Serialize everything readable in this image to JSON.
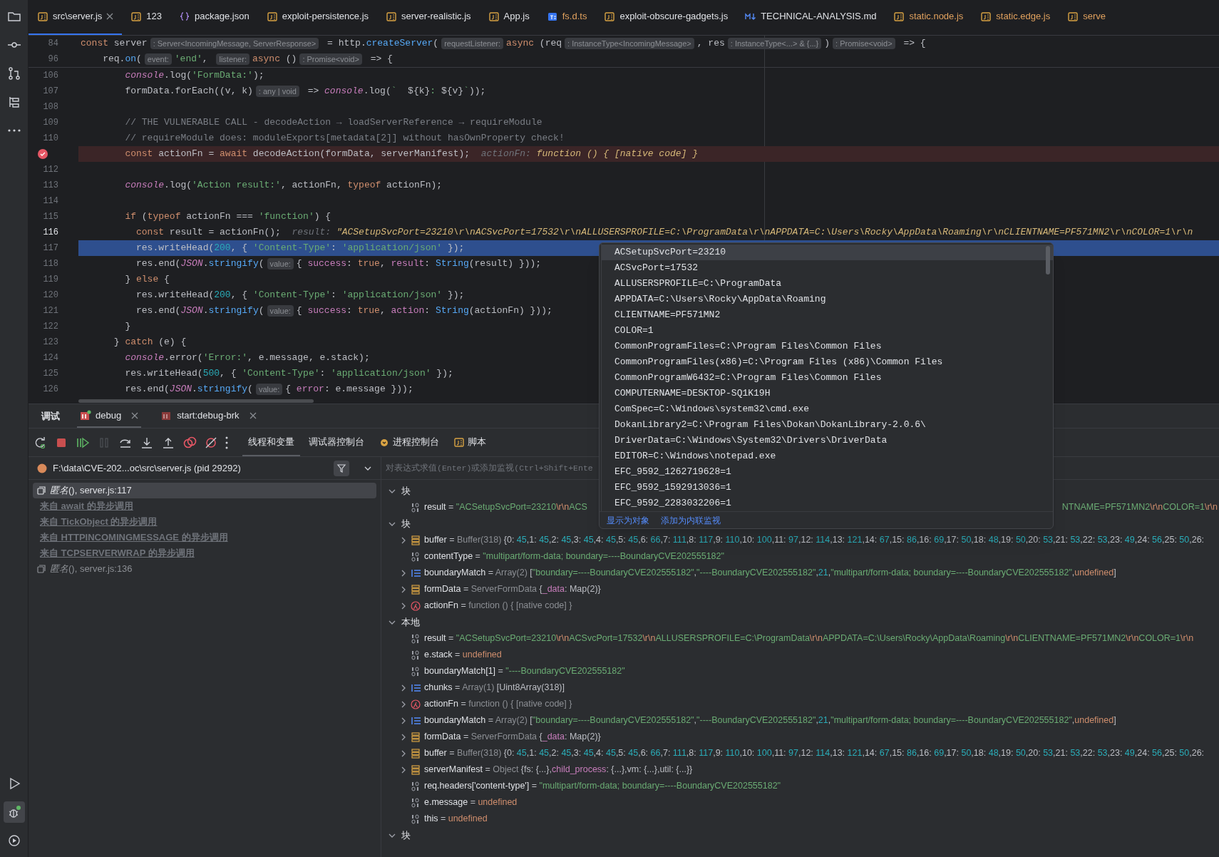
{
  "activity_bar": {
    "top": [
      {
        "kind": "folder",
        "selected": false
      },
      {
        "kind": "commit",
        "selected": false
      },
      {
        "kind": "pull-request",
        "selected": false
      },
      {
        "kind": "structure",
        "selected": false
      },
      {
        "kind": "more",
        "selected": false
      }
    ],
    "bottom": [
      {
        "kind": "run",
        "selected": false
      },
      {
        "kind": "debug",
        "selected": true
      },
      {
        "kind": "services",
        "selected": false
      }
    ]
  },
  "tabs": [
    {
      "label": "src\\server.js",
      "kind": "js",
      "selected": true,
      "color": "#dfe1e5"
    },
    {
      "label": "123",
      "kind": "js",
      "selected": false,
      "color": "#dfe1e5"
    },
    {
      "label": "package.json",
      "kind": "json",
      "selected": false,
      "color": "#dfe1e5"
    },
    {
      "label": "exploit-persistence.js",
      "kind": "js",
      "selected": false,
      "color": "#dfe1e5"
    },
    {
      "label": "server-realistic.js",
      "kind": "js",
      "selected": false,
      "color": "#dfe1e5"
    },
    {
      "label": "App.js",
      "kind": "js",
      "selected": false,
      "color": "#dfe1e5"
    },
    {
      "label": "fs.d.ts",
      "kind": "ts",
      "selected": false,
      "color": "#e0a15e"
    },
    {
      "label": "exploit-obscure-gadgets.js",
      "kind": "js",
      "selected": false,
      "color": "#dfe1e5"
    },
    {
      "label": "TECHNICAL-ANALYSIS.md",
      "kind": "md",
      "selected": false,
      "color": "#dfe1e5"
    },
    {
      "label": "static.node.js",
      "kind": "js",
      "selected": false,
      "color": "#e0a15e"
    },
    {
      "label": "static.edge.js",
      "kind": "js",
      "selected": false,
      "color": "#e0a15e"
    },
    {
      "label": "serve",
      "kind": "js",
      "selected": false,
      "color": "#e0a15e"
    }
  ],
  "sticky_lines": [
    {
      "n": "84",
      "tokens": [
        {
          "kind": "k",
          "text": "const "
        },
        {
          "kind": "p",
          "text": "server"
        },
        {
          "kind": "h",
          "text": ": Server<IncomingMessage, ServerResponse>"
        },
        {
          "kind": "p",
          "text": " = http."
        },
        {
          "kind": "f",
          "text": "createServer"
        },
        {
          "kind": "p",
          "text": "("
        },
        {
          "kind": "h",
          "text": "requestListener:"
        },
        {
          "kind": "k",
          "text": "async "
        },
        {
          "kind": "p",
          "text": "(req"
        },
        {
          "kind": "h",
          "text": ": InstanceType<IncomingMessage>"
        },
        {
          "kind": "p",
          "text": ", res"
        },
        {
          "kind": "h",
          "text": ": InstanceType<...> & {...}"
        },
        {
          "kind": "p",
          "text": ")"
        },
        {
          "kind": "h",
          "text": ": Promise<void>"
        },
        {
          "kind": "p",
          "text": " => {"
        }
      ]
    },
    {
      "n": "96",
      "tokens": [
        {
          "kind": "p",
          "text": "    req."
        },
        {
          "kind": "f",
          "text": "on"
        },
        {
          "kind": "p",
          "text": "("
        },
        {
          "kind": "h",
          "text": "event:"
        },
        {
          "kind": "s",
          "text": "'end'"
        },
        {
          "kind": "p",
          "text": ", "
        },
        {
          "kind": "h",
          "text": "listener:"
        },
        {
          "kind": "k",
          "text": "async "
        },
        {
          "kind": "p",
          "text": "()"
        },
        {
          "kind": "h",
          "text": ": Promise<void>"
        },
        {
          "kind": "p",
          "text": " => {"
        }
      ]
    }
  ],
  "code_lines": [
    {
      "n": "106",
      "breakpoint": false,
      "current_line": false,
      "caret": false,
      "tokens": [
        {
          "kind": "i",
          "text": "        console"
        },
        {
          "kind": "p",
          "text": ".log("
        },
        {
          "kind": "s",
          "text": "'FormData:'"
        },
        {
          "kind": "p",
          "text": ");"
        }
      ]
    },
    {
      "n": "107",
      "breakpoint": false,
      "current_line": false,
      "caret": false,
      "tokens": [
        {
          "kind": "p",
          "text": "        formData.forEach((v, k)"
        },
        {
          "kind": "h",
          "text": ": any | void"
        },
        {
          "kind": "p",
          "text": " => "
        },
        {
          "kind": "i",
          "text": "console"
        },
        {
          "kind": "p",
          "text": ".log("
        },
        {
          "kind": "s",
          "text": "`  "
        },
        {
          "kind": "p",
          "text": "${k}"
        },
        {
          "kind": "s",
          "text": ": "
        },
        {
          "kind": "p",
          "text": "${v}"
        },
        {
          "kind": "s",
          "text": "`"
        },
        {
          "kind": "p",
          "text": "));"
        }
      ]
    },
    {
      "n": "108",
      "breakpoint": false,
      "current_line": false,
      "caret": false
    },
    {
      "n": "109",
      "breakpoint": false,
      "current_line": false,
      "caret": false,
      "tokens": [
        {
          "kind": "c",
          "text": "        // THE VULNERABLE CALL - decodeAction → loadServerReference → requireModule"
        }
      ]
    },
    {
      "n": "110",
      "breakpoint": false,
      "current_line": false,
      "caret": false,
      "tokens": [
        {
          "kind": "c",
          "text": "        // requireModule does: moduleExports[metadata[2]] without hasOwnProperty check!"
        }
      ]
    },
    {
      "breakpoint": true,
      "current_line": false,
      "tokens": [
        {
          "kind": "k",
          "text": "        const "
        },
        {
          "kind": "p",
          "text": "actionFn = "
        },
        {
          "kind": "k",
          "text": "await "
        },
        {
          "kind": "p",
          "text": "decodeAction(formData, serverManifest);"
        },
        {
          "kind": "dl",
          "text": "  actionFn: "
        },
        {
          "kind": "dv",
          "text": "function () { [native code] }"
        }
      ]
    },
    {
      "n": "112",
      "breakpoint": false,
      "current_line": false,
      "caret": false
    },
    {
      "n": "113",
      "breakpoint": false,
      "current_line": false,
      "caret": false,
      "tokens": [
        {
          "kind": "i",
          "text": "        console"
        },
        {
          "kind": "p",
          "text": ".log("
        },
        {
          "kind": "s",
          "text": "'Action result:'"
        },
        {
          "kind": "p",
          "text": ", actionFn, "
        },
        {
          "kind": "k",
          "text": "typeof "
        },
        {
          "kind": "p",
          "text": "actionFn);"
        }
      ]
    },
    {
      "n": "114",
      "breakpoint": false,
      "current_line": false,
      "caret": false
    },
    {
      "n": "115",
      "breakpoint": false,
      "current_line": false,
      "caret": false,
      "tokens": [
        {
          "kind": "k",
          "text": "        if "
        },
        {
          "kind": "p",
          "text": "("
        },
        {
          "kind": "k",
          "text": "typeof "
        },
        {
          "kind": "p",
          "text": "actionFn === "
        },
        {
          "kind": "s",
          "text": "'function'"
        },
        {
          "kind": "p",
          "text": ") {"
        }
      ]
    },
    {
      "n": "116",
      "breakpoint": false,
      "current_line": false,
      "caret": true,
      "tokens": [
        {
          "kind": "k",
          "text": "          const "
        },
        {
          "kind": "p",
          "text": "result = actionFn();"
        },
        {
          "kind": "dl",
          "text": "  result: "
        },
        {
          "kind": "dv",
          "text": "\"ACSetupSvcPort=23210\\r\\nACSvcPort=17532\\r\\nALLUSERSPROFILE=C:\\ProgramData\\r\\nAPPDATA=C:\\Users\\Rocky\\AppData\\Roaming\\r\\nCLIENTNAME=PF571MN2\\r\\nCOLOR=1\\r\\n"
        }
      ]
    },
    {
      "n": "117",
      "breakpoint": false,
      "current_line": true,
      "caret": false,
      "tokens": [
        {
          "kind": "p",
          "text": "          res.writeHead("
        },
        {
          "kind": "n",
          "text": "200"
        },
        {
          "kind": "p",
          "text": ", { "
        },
        {
          "kind": "s",
          "text": "'Content-Type'"
        },
        {
          "kind": "p",
          "text": ": "
        },
        {
          "kind": "s",
          "text": "'application/json'"
        },
        {
          "kind": "p",
          "text": " });"
        }
      ]
    },
    {
      "n": "118",
      "breakpoint": false,
      "current_line": false,
      "caret": false,
      "tokens": [
        {
          "kind": "p",
          "text": "          res.end("
        },
        {
          "kind": "i",
          "text": "JSON"
        },
        {
          "kind": "p",
          "text": "."
        },
        {
          "kind": "f",
          "text": "stringify"
        },
        {
          "kind": "p",
          "text": "("
        },
        {
          "kind": "h",
          "text": "value:"
        },
        {
          "kind": "p",
          "text": "{ "
        },
        {
          "kind": "pr",
          "text": "success"
        },
        {
          "kind": "p",
          "text": ": "
        },
        {
          "kind": "k",
          "text": "true"
        },
        {
          "kind": "p",
          "text": ", "
        },
        {
          "kind": "pr",
          "text": "result"
        },
        {
          "kind": "p",
          "text": ": "
        },
        {
          "kind": "f",
          "text": "String"
        },
        {
          "kind": "p",
          "text": "(result) }));"
        }
      ]
    },
    {
      "n": "119",
      "breakpoint": false,
      "current_line": false,
      "caret": false,
      "tokens": [
        {
          "kind": "p",
          "text": "        } "
        },
        {
          "kind": "k",
          "text": "else "
        },
        {
          "kind": "p",
          "text": "{"
        }
      ]
    },
    {
      "n": "120",
      "breakpoint": false,
      "current_line": false,
      "caret": false,
      "tokens": [
        {
          "kind": "p",
          "text": "          res.writeHead("
        },
        {
          "kind": "n",
          "text": "200"
        },
        {
          "kind": "p",
          "text": ", { "
        },
        {
          "kind": "s",
          "text": "'Content-Type'"
        },
        {
          "kind": "p",
          "text": ": "
        },
        {
          "kind": "s",
          "text": "'application/json'"
        },
        {
          "kind": "p",
          "text": " });"
        }
      ]
    },
    {
      "n": "121",
      "breakpoint": false,
      "current_line": false,
      "caret": false,
      "tokens": [
        {
          "kind": "p",
          "text": "          res.end("
        },
        {
          "kind": "i",
          "text": "JSON"
        },
        {
          "kind": "p",
          "text": "."
        },
        {
          "kind": "f",
          "text": "stringify"
        },
        {
          "kind": "p",
          "text": "("
        },
        {
          "kind": "h",
          "text": "value:"
        },
        {
          "kind": "p",
          "text": "{ "
        },
        {
          "kind": "pr",
          "text": "success"
        },
        {
          "kind": "p",
          "text": ": "
        },
        {
          "kind": "k",
          "text": "true"
        },
        {
          "kind": "p",
          "text": ", "
        },
        {
          "kind": "pr",
          "text": "action"
        },
        {
          "kind": "p",
          "text": ": "
        },
        {
          "kind": "f",
          "text": "String"
        },
        {
          "kind": "p",
          "text": "(actionFn) }));"
        }
      ]
    },
    {
      "n": "122",
      "breakpoint": false,
      "current_line": false,
      "caret": false,
      "tokens": [
        {
          "kind": "p",
          "text": "        }"
        }
      ]
    },
    {
      "n": "123",
      "breakpoint": false,
      "current_line": false,
      "caret": false,
      "tokens": [
        {
          "kind": "p",
          "text": "      } "
        },
        {
          "kind": "k",
          "text": "catch "
        },
        {
          "kind": "p",
          "text": "(e) {"
        }
      ]
    },
    {
      "n": "124",
      "breakpoint": false,
      "current_line": false,
      "caret": false,
      "tokens": [
        {
          "kind": "i",
          "text": "        console"
        },
        {
          "kind": "p",
          "text": ".error("
        },
        {
          "kind": "s",
          "text": "'Error:'"
        },
        {
          "kind": "p",
          "text": ", e.message, e.stack);"
        }
      ]
    },
    {
      "n": "125",
      "breakpoint": false,
      "current_line": false,
      "caret": false,
      "tokens": [
        {
          "kind": "p",
          "text": "        res.writeHead("
        },
        {
          "kind": "n",
          "text": "500"
        },
        {
          "kind": "p",
          "text": ", { "
        },
        {
          "kind": "s",
          "text": "'Content-Type'"
        },
        {
          "kind": "p",
          "text": ": "
        },
        {
          "kind": "s",
          "text": "'application/json'"
        },
        {
          "kind": "p",
          "text": " });"
        }
      ]
    },
    {
      "n": "126",
      "breakpoint": false,
      "current_line": false,
      "caret": false,
      "tokens": [
        {
          "kind": "p",
          "text": "        res.end("
        },
        {
          "kind": "i",
          "text": "JSON"
        },
        {
          "kind": "p",
          "text": "."
        },
        {
          "kind": "f",
          "text": "stringify"
        },
        {
          "kind": "p",
          "text": "("
        },
        {
          "kind": "h",
          "text": "value:"
        },
        {
          "kind": "p",
          "text": "{ "
        },
        {
          "kind": "pr",
          "text": "error"
        },
        {
          "kind": "p",
          "text": ": e.message }));"
        }
      ]
    }
  ],
  "debug": {
    "title": "调试",
    "sessions": [
      {
        "label": "debug",
        "kind": "running",
        "selected": true
      },
      {
        "label": "start:debug-brk",
        "kind": "stopped",
        "selected": false
      }
    ],
    "toolbar": [
      {
        "kind": "rerun",
        "disabled": false
      },
      {
        "kind": "stop",
        "disabled": false
      },
      {
        "kind": "resume",
        "disabled": false
      },
      {
        "kind": "pause",
        "disabled": true
      },
      {
        "kind": "step-over",
        "disabled": false
      },
      {
        "kind": "step-into",
        "disabled": false
      },
      {
        "kind": "step-out",
        "disabled": false
      },
      {
        "kind": "breakpoints",
        "disabled": false
      },
      {
        "kind": "mute",
        "disabled": false
      },
      {
        "kind": "more",
        "disabled": false
      }
    ],
    "views": [
      {
        "label": "线程和变量",
        "kind": "plain",
        "selected": true
      },
      {
        "label": "调试器控制台",
        "kind": "plain",
        "selected": false
      },
      {
        "label": "进程控制台",
        "kind": "console",
        "selected": false
      },
      {
        "label": "脚本",
        "kind": "js",
        "selected": false
      }
    ],
    "thread": "F:\\data\\CVE-202...oc\\src\\server.js (pid 29292)",
    "frames": [
      {
        "kind": "frame",
        "label": "*匿名*(), server.js:117",
        "selected": true
      },
      {
        "kind": "async",
        "label": "来自 await 的异步调用",
        "selected": false
      },
      {
        "kind": "async",
        "label": "来自 TickObject 的异步调用",
        "selected": false
      },
      {
        "kind": "async",
        "label": "来自 HTTPINCOMINGMESSAGE 的异步调用",
        "selected": false
      },
      {
        "kind": "async",
        "label": "来自 TCPSERVERWRAP 的异步调用",
        "selected": false
      },
      {
        "kind": "frame",
        "label": "*匿名*(), server.js:136",
        "selected": false
      }
    ],
    "watch_placeholder": "对表达式求值(Enter)或添加监视(Ctrl+Shift+Ente",
    "variables": [
      {
        "label": "块",
        "expanded": true,
        "children": [
          {
            "kind": "primitive",
            "name": "result",
            "expandable": false,
            "value": [
              {
                "kind": "p",
                "text": "= "
              },
              {
                "kind": "s",
                "text": "\"ACSetupSvcPort=23210\\r\\nACS"
              }
            ],
            "value_after_popup": [
              {
                "kind": "s",
                "text": "NTNAME=PF571MN2\\r\\nCOLOR=1\\r\\n"
              }
            ]
          }
        ]
      },
      {
        "label": "块",
        "expanded": true,
        "children": [
          {
            "kind": "object",
            "name": "buffer",
            "expandable": true,
            "value": [
              {
                "kind": "p",
                "text": "= "
              },
              {
                "kind": "g",
                "text": "Buffer(318) "
              },
              {
                "kind": "p",
                "text": "{0: "
              },
              {
                "kind": "n",
                "text": "45"
              },
              {
                "kind": "p",
                "text": ",1: "
              },
              {
                "kind": "n",
                "text": "45"
              },
              {
                "kind": "p",
                "text": ",2: "
              },
              {
                "kind": "n",
                "text": "45"
              },
              {
                "kind": "p",
                "text": ",3: "
              },
              {
                "kind": "n",
                "text": "45"
              },
              {
                "kind": "p",
                "text": ",4: "
              },
              {
                "kind": "n",
                "text": "45"
              },
              {
                "kind": "p",
                "text": ",5: "
              },
              {
                "kind": "n",
                "text": "45"
              },
              {
                "kind": "p",
                "text": ",6: "
              },
              {
                "kind": "n",
                "text": "66"
              },
              {
                "kind": "p",
                "text": ",7: "
              },
              {
                "kind": "n",
                "text": "111"
              },
              {
                "kind": "p",
                "text": ",8: "
              },
              {
                "kind": "n",
                "text": "117"
              },
              {
                "kind": "p",
                "text": ",9: "
              },
              {
                "kind": "n",
                "text": "110"
              },
              {
                "kind": "p",
                "text": ",10: "
              },
              {
                "kind": "n",
                "text": "100"
              },
              {
                "kind": "p",
                "text": ",11: "
              },
              {
                "kind": "n",
                "text": "97"
              },
              {
                "kind": "p",
                "text": ",12: "
              },
              {
                "kind": "n",
                "text": "114"
              },
              {
                "kind": "p",
                "text": ",13: "
              },
              {
                "kind": "n",
                "text": "121"
              },
              {
                "kind": "p",
                "text": ",14: "
              },
              {
                "kind": "n",
                "text": "67"
              },
              {
                "kind": "p",
                "text": ",15: "
              },
              {
                "kind": "n",
                "text": "86"
              },
              {
                "kind": "p",
                "text": ",16: "
              },
              {
                "kind": "n",
                "text": "69"
              },
              {
                "kind": "p",
                "text": ",17: "
              },
              {
                "kind": "n",
                "text": "50"
              },
              {
                "kind": "p",
                "text": ",18: "
              },
              {
                "kind": "n",
                "text": "48"
              },
              {
                "kind": "p",
                "text": ",19: "
              },
              {
                "kind": "n",
                "text": "50"
              },
              {
                "kind": "p",
                "text": ",20: "
              },
              {
                "kind": "n",
                "text": "53"
              },
              {
                "kind": "p",
                "text": ",21: "
              },
              {
                "kind": "n",
                "text": "53"
              },
              {
                "kind": "p",
                "text": ",22: "
              },
              {
                "kind": "n",
                "text": "53"
              },
              {
                "kind": "p",
                "text": ",23: "
              },
              {
                "kind": "n",
                "text": "49"
              },
              {
                "kind": "p",
                "text": ",24: "
              },
              {
                "kind": "n",
                "text": "56"
              },
              {
                "kind": "p",
                "text": ",25: "
              },
              {
                "kind": "n",
                "text": "50"
              },
              {
                "kind": "p",
                "text": ",26:"
              }
            ]
          },
          {
            "kind": "primitive",
            "name": "contentType",
            "expandable": false,
            "value": [
              {
                "kind": "p",
                "text": "= "
              },
              {
                "kind": "s",
                "text": "\"multipart/form-data; boundary=----BoundaryCVE202555182\""
              }
            ]
          },
          {
            "kind": "array",
            "name": "boundaryMatch",
            "expandable": true,
            "value": [
              {
                "kind": "p",
                "text": "= "
              },
              {
                "kind": "g",
                "text": "Array(2) "
              },
              {
                "kind": "p",
                "text": "["
              },
              {
                "kind": "s",
                "text": "\"boundary=----BoundaryCVE202555182\""
              },
              {
                "kind": "p",
                "text": ","
              },
              {
                "kind": "s",
                "text": "\"----BoundaryCVE202555182\""
              },
              {
                "kind": "p",
                "text": ","
              },
              {
                "kind": "n",
                "text": "21"
              },
              {
                "kind": "p",
                "text": ","
              },
              {
                "kind": "s",
                "text": "\"multipart/form-data; boundary=----BoundaryCVE202555182\""
              },
              {
                "kind": "p",
                "text": ","
              },
              {
                "kind": "k",
                "text": "undefined"
              },
              {
                "kind": "p",
                "text": "]"
              }
            ]
          },
          {
            "kind": "object",
            "name": "formData",
            "expandable": true,
            "value": [
              {
                "kind": "p",
                "text": "= "
              },
              {
                "kind": "g",
                "text": "ServerFormData "
              },
              {
                "kind": "p",
                "text": "{"
              },
              {
                "kind": "pr",
                "text": "_data"
              },
              {
                "kind": "p",
                "text": ": Map(2)}"
              }
            ]
          },
          {
            "kind": "function",
            "name": "actionFn",
            "expandable": true,
            "value": [
              {
                "kind": "p",
                "text": "= "
              },
              {
                "kind": "g",
                "text": "function () { [native code] }"
              }
            ]
          }
        ]
      },
      {
        "label": "本地",
        "expanded": true,
        "children": [
          {
            "kind": "primitive",
            "name": "result",
            "expandable": false,
            "value": [
              {
                "kind": "p",
                "text": "= "
              },
              {
                "kind": "s",
                "text": "\"ACSetupSvcPort=23210\\r\\nACSvcPort=17532\\r\\nALLUSERSPROFILE=C:\\ProgramData\\r\\nAPPDATA=C:\\Users\\Rocky\\AppData\\Roaming\\r\\nCLIENTNAME=PF571MN2\\r\\nCOLOR=1\\r\\n"
              }
            ]
          },
          {
            "kind": "primitive",
            "name": "e.stack",
            "expandable": false,
            "value": [
              {
                "kind": "p",
                "text": "= "
              },
              {
                "kind": "k",
                "text": "undefined"
              }
            ]
          },
          {
            "kind": "primitive",
            "name": "boundaryMatch[1]",
            "expandable": false,
            "value": [
              {
                "kind": "p",
                "text": "= "
              },
              {
                "kind": "s",
                "text": "\"----BoundaryCVE202555182\""
              }
            ]
          },
          {
            "kind": "array",
            "name": "chunks",
            "expandable": true,
            "value": [
              {
                "kind": "p",
                "text": "= "
              },
              {
                "kind": "g",
                "text": "Array(1) "
              },
              {
                "kind": "p",
                "text": "[Uint8Array(318)]"
              }
            ]
          },
          {
            "kind": "function",
            "name": "actionFn",
            "expandable": true,
            "value": [
              {
                "kind": "p",
                "text": "= "
              },
              {
                "kind": "g",
                "text": "function () { [native code] }"
              }
            ]
          },
          {
            "kind": "array",
            "name": "boundaryMatch",
            "expandable": true,
            "value": [
              {
                "kind": "p",
                "text": "= "
              },
              {
                "kind": "g",
                "text": "Array(2) "
              },
              {
                "kind": "p",
                "text": "["
              },
              {
                "kind": "s",
                "text": "\"boundary=----BoundaryCVE202555182\""
              },
              {
                "kind": "p",
                "text": ","
              },
              {
                "kind": "s",
                "text": "\"----BoundaryCVE202555182\""
              },
              {
                "kind": "p",
                "text": ","
              },
              {
                "kind": "n",
                "text": "21"
              },
              {
                "kind": "p",
                "text": ","
              },
              {
                "kind": "s",
                "text": "\"multipart/form-data; boundary=----BoundaryCVE202555182\""
              },
              {
                "kind": "p",
                "text": ","
              },
              {
                "kind": "k",
                "text": "undefined"
              },
              {
                "kind": "p",
                "text": "]"
              }
            ]
          },
          {
            "kind": "object",
            "name": "formData",
            "expandable": true,
            "value": [
              {
                "kind": "p",
                "text": "= "
              },
              {
                "kind": "g",
                "text": "ServerFormData "
              },
              {
                "kind": "p",
                "text": "{"
              },
              {
                "kind": "pr",
                "text": "_data"
              },
              {
                "kind": "p",
                "text": ": Map(2)}"
              }
            ]
          },
          {
            "kind": "object",
            "name": "buffer",
            "expandable": true,
            "value": [
              {
                "kind": "p",
                "text": "= "
              },
              {
                "kind": "g",
                "text": "Buffer(318) "
              },
              {
                "kind": "p",
                "text": "{0: "
              },
              {
                "kind": "n",
                "text": "45"
              },
              {
                "kind": "p",
                "text": ",1: "
              },
              {
                "kind": "n",
                "text": "45"
              },
              {
                "kind": "p",
                "text": ",2: "
              },
              {
                "kind": "n",
                "text": "45"
              },
              {
                "kind": "p",
                "text": ",3: "
              },
              {
                "kind": "n",
                "text": "45"
              },
              {
                "kind": "p",
                "text": ",4: "
              },
              {
                "kind": "n",
                "text": "45"
              },
              {
                "kind": "p",
                "text": ",5: "
              },
              {
                "kind": "n",
                "text": "45"
              },
              {
                "kind": "p",
                "text": ",6: "
              },
              {
                "kind": "n",
                "text": "66"
              },
              {
                "kind": "p",
                "text": ",7: "
              },
              {
                "kind": "n",
                "text": "111"
              },
              {
                "kind": "p",
                "text": ",8: "
              },
              {
                "kind": "n",
                "text": "117"
              },
              {
                "kind": "p",
                "text": ",9: "
              },
              {
                "kind": "n",
                "text": "110"
              },
              {
                "kind": "p",
                "text": ",10: "
              },
              {
                "kind": "n",
                "text": "100"
              },
              {
                "kind": "p",
                "text": ",11: "
              },
              {
                "kind": "n",
                "text": "97"
              },
              {
                "kind": "p",
                "text": ",12: "
              },
              {
                "kind": "n",
                "text": "114"
              },
              {
                "kind": "p",
                "text": ",13: "
              },
              {
                "kind": "n",
                "text": "121"
              },
              {
                "kind": "p",
                "text": ",14: "
              },
              {
                "kind": "n",
                "text": "67"
              },
              {
                "kind": "p",
                "text": ",15: "
              },
              {
                "kind": "n",
                "text": "86"
              },
              {
                "kind": "p",
                "text": ",16: "
              },
              {
                "kind": "n",
                "text": "69"
              },
              {
                "kind": "p",
                "text": ",17: "
              },
              {
                "kind": "n",
                "text": "50"
              },
              {
                "kind": "p",
                "text": ",18: "
              },
              {
                "kind": "n",
                "text": "48"
              },
              {
                "kind": "p",
                "text": ",19: "
              },
              {
                "kind": "n",
                "text": "50"
              },
              {
                "kind": "p",
                "text": ",20: "
              },
              {
                "kind": "n",
                "text": "53"
              },
              {
                "kind": "p",
                "text": ",21: "
              },
              {
                "kind": "n",
                "text": "53"
              },
              {
                "kind": "p",
                "text": ",22: "
              },
              {
                "kind": "n",
                "text": "53"
              },
              {
                "kind": "p",
                "text": ",23: "
              },
              {
                "kind": "n",
                "text": "49"
              },
              {
                "kind": "p",
                "text": ",24: "
              },
              {
                "kind": "n",
                "text": "56"
              },
              {
                "kind": "p",
                "text": ",25: "
              },
              {
                "kind": "n",
                "text": "50"
              },
              {
                "kind": "p",
                "text": ",26:"
              }
            ]
          },
          {
            "kind": "object",
            "name": "serverManifest",
            "expandable": true,
            "value": [
              {
                "kind": "p",
                "text": "= "
              },
              {
                "kind": "g",
                "text": "Object "
              },
              {
                "kind": "p",
                "text": "{fs: {...},"
              },
              {
                "kind": "pr",
                "text": "child_process"
              },
              {
                "kind": "p",
                "text": ": {...},vm: {...},util: {...}}"
              }
            ]
          },
          {
            "kind": "primitive",
            "name": "req.headers['content-type']",
            "expandable": false,
            "value": [
              {
                "kind": "p",
                "text": "= "
              },
              {
                "kind": "s",
                "text": "\"multipart/form-data; boundary=----BoundaryCVE202555182\""
              }
            ]
          },
          {
            "kind": "primitive",
            "name": "e.message",
            "expandable": false,
            "value": [
              {
                "kind": "p",
                "text": "= "
              },
              {
                "kind": "k",
                "text": "undefined"
              }
            ]
          },
          {
            "kind": "primitive",
            "name": "this",
            "expandable": false,
            "value": [
              {
                "kind": "p",
                "text": "= "
              },
              {
                "kind": "k",
                "text": "undefined"
              }
            ]
          }
        ]
      },
      {
        "label": "块",
        "expanded": true
      }
    ]
  },
  "popup": {
    "lines": [
      {
        "text": "ACSetupSvcPort=23210",
        "selected": true
      },
      {
        "text": "ACSvcPort=17532",
        "selected": false
      },
      {
        "text": "ALLUSERSPROFILE=C:\\ProgramData",
        "selected": false
      },
      {
        "text": "APPDATA=C:\\Users\\Rocky\\AppData\\Roaming",
        "selected": false
      },
      {
        "text": "CLIENTNAME=PF571MN2",
        "selected": false
      },
      {
        "text": "COLOR=1",
        "selected": false
      },
      {
        "text": "CommonProgramFiles=C:\\Program Files\\Common Files",
        "selected": false
      },
      {
        "text": "CommonProgramFiles(x86)=C:\\Program Files (x86)\\Common Files",
        "selected": false
      },
      {
        "text": "CommonProgramW6432=C:\\Program Files\\Common Files",
        "selected": false
      },
      {
        "text": "COMPUTERNAME=DESKTOP-SQ1K19H",
        "selected": false
      },
      {
        "text": "ComSpec=C:\\Windows\\system32\\cmd.exe",
        "selected": false
      },
      {
        "text": "DokanLibrary2=C:\\Program Files\\Dokan\\DokanLibrary-2.0.6\\",
        "selected": false
      },
      {
        "text": "DriverData=C:\\Windows\\System32\\Drivers\\DriverData",
        "selected": false
      },
      {
        "text": "EDITOR=C:\\Windows\\notepad.exe",
        "selected": false
      },
      {
        "text": "EFC_9592_1262719628=1",
        "selected": false
      },
      {
        "text": "EFC_9592_1592913036=1",
        "selected": false
      },
      {
        "text": "EFC_9592_2283032206=1",
        "selected": false
      }
    ],
    "links": [
      "显示为对象",
      "添加为内联监视"
    ]
  }
}
